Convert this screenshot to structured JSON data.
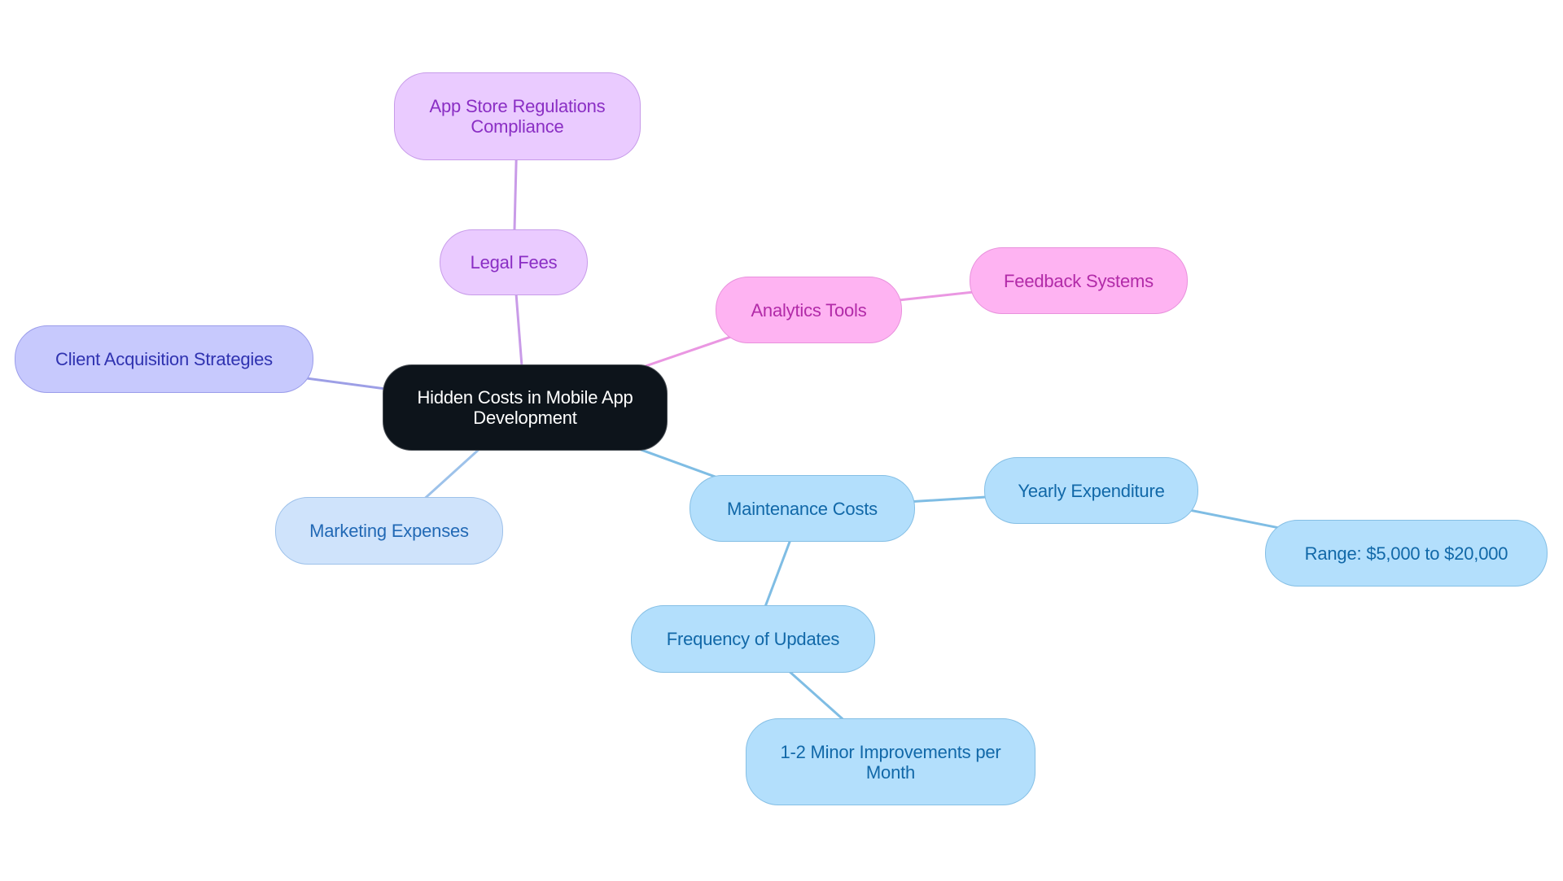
{
  "diagram": {
    "type": "mind-map",
    "root": {
      "id": "root",
      "label": "Hidden Costs in Mobile App Development"
    },
    "nodes": [
      {
        "id": "root",
        "label": "Hidden Costs in Mobile App Development",
        "style": "root"
      },
      {
        "id": "legal",
        "label": "Legal Fees",
        "style": "purple",
        "parent": "root"
      },
      {
        "id": "appstore",
        "label": "App Store Regulations Compliance",
        "style": "purple",
        "parent": "legal"
      },
      {
        "id": "analytics",
        "label": "Analytics Tools",
        "style": "pink",
        "parent": "root"
      },
      {
        "id": "feedback",
        "label": "Feedback Systems",
        "style": "pink",
        "parent": "analytics"
      },
      {
        "id": "client",
        "label": "Client Acquisition Strategies",
        "style": "indigo",
        "parent": "root"
      },
      {
        "id": "marketing",
        "label": "Marketing Expenses",
        "style": "lightblue",
        "parent": "root"
      },
      {
        "id": "maintenance",
        "label": "Maintenance Costs",
        "style": "sky",
        "parent": "root"
      },
      {
        "id": "yearly",
        "label": "Yearly Expenditure",
        "style": "sky",
        "parent": "maintenance"
      },
      {
        "id": "range",
        "label": "Range: $5,000 to $20,000",
        "style": "sky",
        "parent": "yearly"
      },
      {
        "id": "frequency",
        "label": "Frequency of Updates",
        "style": "sky",
        "parent": "maintenance"
      },
      {
        "id": "minor",
        "label": "1-2 Minor Improvements per Month",
        "style": "sky",
        "parent": "frequency"
      }
    ],
    "edges": [
      {
        "from": "root",
        "to": "legal",
        "color": "#c99be8"
      },
      {
        "from": "legal",
        "to": "appstore",
        "color": "#c99be8"
      },
      {
        "from": "root",
        "to": "analytics",
        "color": "#ea97e2"
      },
      {
        "from": "analytics",
        "to": "feedback",
        "color": "#ea97e2"
      },
      {
        "from": "root",
        "to": "client",
        "color": "#9d9fe6"
      },
      {
        "from": "root",
        "to": "marketing",
        "color": "#9dc2ea"
      },
      {
        "from": "root",
        "to": "maintenance",
        "color": "#7fbde4"
      },
      {
        "from": "maintenance",
        "to": "yearly",
        "color": "#7fbde4"
      },
      {
        "from": "yearly",
        "to": "range",
        "color": "#7fbde4"
      },
      {
        "from": "maintenance",
        "to": "frequency",
        "color": "#7fbde4"
      },
      {
        "from": "frequency",
        "to": "minor",
        "color": "#7fbde4"
      }
    ],
    "colors": {
      "root_fill": "#0d141b",
      "purple_fill": "#eacbff",
      "pink_fill": "#feb3f2",
      "indigo_fill": "#c7c9fd",
      "lightblue_fill": "#cfe3fb",
      "sky_fill": "#b3dffc"
    }
  }
}
